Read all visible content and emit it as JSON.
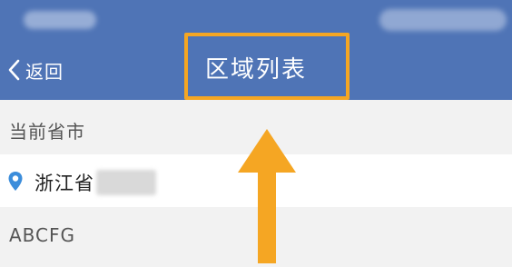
{
  "nav": {
    "back_label": "返回",
    "title": "区域列表"
  },
  "sections": {
    "current_header": "当前省市",
    "current_province": "浙江省",
    "letter_header": "ABCFG"
  },
  "colors": {
    "nav_background": "#4f74b6",
    "highlight": "#f5a623",
    "pin": "#3b8ddb",
    "page_background": "#f2f2f2"
  },
  "icons": {
    "back": "chevron-left-icon",
    "location": "location-pin-icon",
    "annotation": "up-arrow-icon"
  }
}
